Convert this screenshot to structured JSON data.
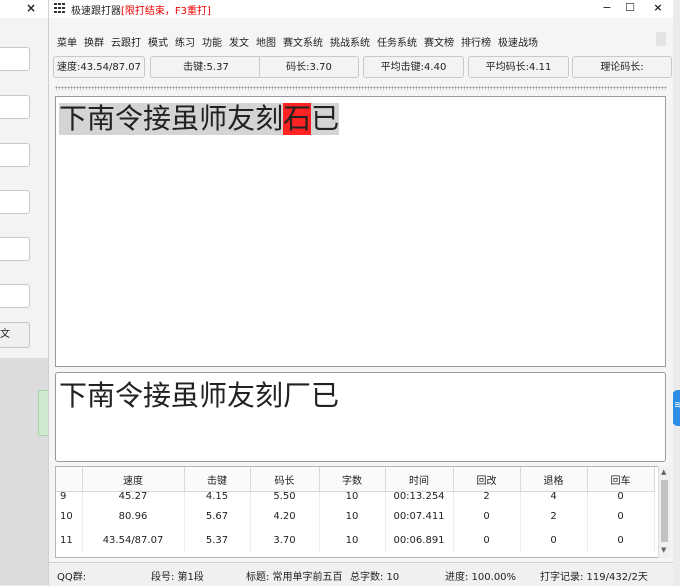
{
  "background_window": {
    "close_symbol": "×",
    "button_partial_label": "文"
  },
  "window": {
    "title": "极速跟打器",
    "title_hint": "[限打结束，F3重打]",
    "controls": [
      "−",
      "☐",
      "×"
    ]
  },
  "menu": [
    "菜单",
    "换群",
    "云跟打",
    "模式",
    "练习",
    "功能",
    "发文",
    "地图",
    "赛文系统",
    "挑战系统",
    "任务系统",
    "赛文榜",
    "排行榜",
    "极速战场"
  ],
  "stats": [
    "速度:43.54/87.07",
    "击键:5.37",
    "码长:3.70",
    "平均击键:4.40",
    "平均码长:4.11",
    "理论码长:"
  ],
  "target_chars": [
    "下",
    "南",
    "令",
    "接",
    "虽",
    "师",
    "友",
    "刻",
    "石",
    "已"
  ],
  "error_index": 8,
  "typed_text": "下南令接虽师友刻厂已",
  "table": {
    "headers": [
      "",
      "速度",
      "击键",
      "码长",
      "字数",
      "时间",
      "回改",
      "退格",
      "回车"
    ],
    "rows": [
      [
        "9",
        "45.27",
        "4.15",
        "5.50",
        "10",
        "00:13.254",
        "2",
        "4",
        "0"
      ],
      [
        "10",
        "80.96",
        "5.67",
        "4.20",
        "10",
        "00:07.411",
        "0",
        "2",
        "0"
      ],
      [
        "11",
        "43.54/87.07",
        "5.37",
        "3.70",
        "10",
        "00:06.891",
        "0",
        "0",
        "0"
      ]
    ]
  },
  "statusbar": {
    "qq": "QQ群:",
    "segment": "段号: 第1段",
    "title": "标题: 常用单字前五百",
    "count": "总字数: 10",
    "progress": "进度: 100.00%",
    "record": "打字记录: 119/432/2天"
  },
  "colors": {
    "error_highlight": "#f22222",
    "typed_highlight": "#d4d4d4",
    "title_hint": "#e00000"
  }
}
